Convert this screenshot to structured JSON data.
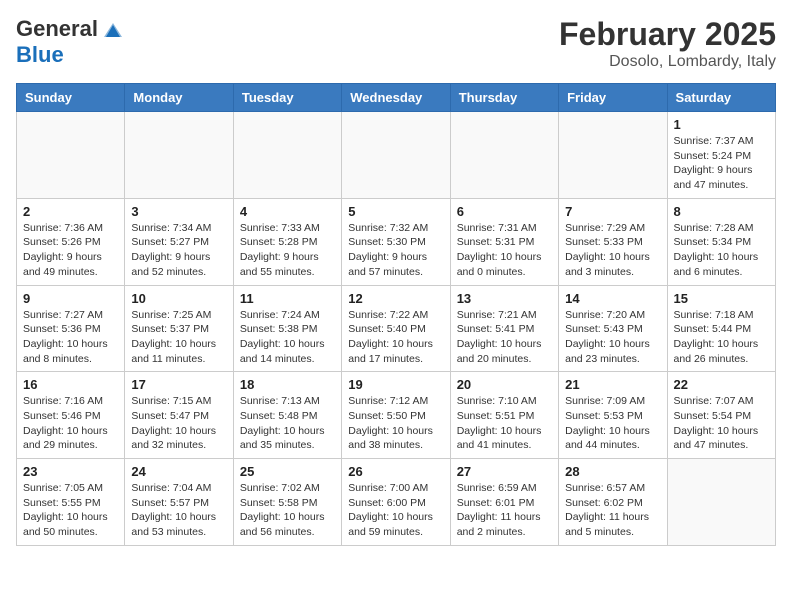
{
  "header": {
    "logo_line1": "General",
    "logo_line2": "Blue",
    "title": "February 2025",
    "subtitle": "Dosolo, Lombardy, Italy"
  },
  "weekdays": [
    "Sunday",
    "Monday",
    "Tuesday",
    "Wednesday",
    "Thursday",
    "Friday",
    "Saturday"
  ],
  "weeks": [
    [
      {
        "day": "",
        "info": ""
      },
      {
        "day": "",
        "info": ""
      },
      {
        "day": "",
        "info": ""
      },
      {
        "day": "",
        "info": ""
      },
      {
        "day": "",
        "info": ""
      },
      {
        "day": "",
        "info": ""
      },
      {
        "day": "1",
        "info": "Sunrise: 7:37 AM\nSunset: 5:24 PM\nDaylight: 9 hours and 47 minutes."
      }
    ],
    [
      {
        "day": "2",
        "info": "Sunrise: 7:36 AM\nSunset: 5:26 PM\nDaylight: 9 hours and 49 minutes."
      },
      {
        "day": "3",
        "info": "Sunrise: 7:34 AM\nSunset: 5:27 PM\nDaylight: 9 hours and 52 minutes."
      },
      {
        "day": "4",
        "info": "Sunrise: 7:33 AM\nSunset: 5:28 PM\nDaylight: 9 hours and 55 minutes."
      },
      {
        "day": "5",
        "info": "Sunrise: 7:32 AM\nSunset: 5:30 PM\nDaylight: 9 hours and 57 minutes."
      },
      {
        "day": "6",
        "info": "Sunrise: 7:31 AM\nSunset: 5:31 PM\nDaylight: 10 hours and 0 minutes."
      },
      {
        "day": "7",
        "info": "Sunrise: 7:29 AM\nSunset: 5:33 PM\nDaylight: 10 hours and 3 minutes."
      },
      {
        "day": "8",
        "info": "Sunrise: 7:28 AM\nSunset: 5:34 PM\nDaylight: 10 hours and 6 minutes."
      }
    ],
    [
      {
        "day": "9",
        "info": "Sunrise: 7:27 AM\nSunset: 5:36 PM\nDaylight: 10 hours and 8 minutes."
      },
      {
        "day": "10",
        "info": "Sunrise: 7:25 AM\nSunset: 5:37 PM\nDaylight: 10 hours and 11 minutes."
      },
      {
        "day": "11",
        "info": "Sunrise: 7:24 AM\nSunset: 5:38 PM\nDaylight: 10 hours and 14 minutes."
      },
      {
        "day": "12",
        "info": "Sunrise: 7:22 AM\nSunset: 5:40 PM\nDaylight: 10 hours and 17 minutes."
      },
      {
        "day": "13",
        "info": "Sunrise: 7:21 AM\nSunset: 5:41 PM\nDaylight: 10 hours and 20 minutes."
      },
      {
        "day": "14",
        "info": "Sunrise: 7:20 AM\nSunset: 5:43 PM\nDaylight: 10 hours and 23 minutes."
      },
      {
        "day": "15",
        "info": "Sunrise: 7:18 AM\nSunset: 5:44 PM\nDaylight: 10 hours and 26 minutes."
      }
    ],
    [
      {
        "day": "16",
        "info": "Sunrise: 7:16 AM\nSunset: 5:46 PM\nDaylight: 10 hours and 29 minutes."
      },
      {
        "day": "17",
        "info": "Sunrise: 7:15 AM\nSunset: 5:47 PM\nDaylight: 10 hours and 32 minutes."
      },
      {
        "day": "18",
        "info": "Sunrise: 7:13 AM\nSunset: 5:48 PM\nDaylight: 10 hours and 35 minutes."
      },
      {
        "day": "19",
        "info": "Sunrise: 7:12 AM\nSunset: 5:50 PM\nDaylight: 10 hours and 38 minutes."
      },
      {
        "day": "20",
        "info": "Sunrise: 7:10 AM\nSunset: 5:51 PM\nDaylight: 10 hours and 41 minutes."
      },
      {
        "day": "21",
        "info": "Sunrise: 7:09 AM\nSunset: 5:53 PM\nDaylight: 10 hours and 44 minutes."
      },
      {
        "day": "22",
        "info": "Sunrise: 7:07 AM\nSunset: 5:54 PM\nDaylight: 10 hours and 47 minutes."
      }
    ],
    [
      {
        "day": "23",
        "info": "Sunrise: 7:05 AM\nSunset: 5:55 PM\nDaylight: 10 hours and 50 minutes."
      },
      {
        "day": "24",
        "info": "Sunrise: 7:04 AM\nSunset: 5:57 PM\nDaylight: 10 hours and 53 minutes."
      },
      {
        "day": "25",
        "info": "Sunrise: 7:02 AM\nSunset: 5:58 PM\nDaylight: 10 hours and 56 minutes."
      },
      {
        "day": "26",
        "info": "Sunrise: 7:00 AM\nSunset: 6:00 PM\nDaylight: 10 hours and 59 minutes."
      },
      {
        "day": "27",
        "info": "Sunrise: 6:59 AM\nSunset: 6:01 PM\nDaylight: 11 hours and 2 minutes."
      },
      {
        "day": "28",
        "info": "Sunrise: 6:57 AM\nSunset: 6:02 PM\nDaylight: 11 hours and 5 minutes."
      },
      {
        "day": "",
        "info": ""
      }
    ]
  ]
}
